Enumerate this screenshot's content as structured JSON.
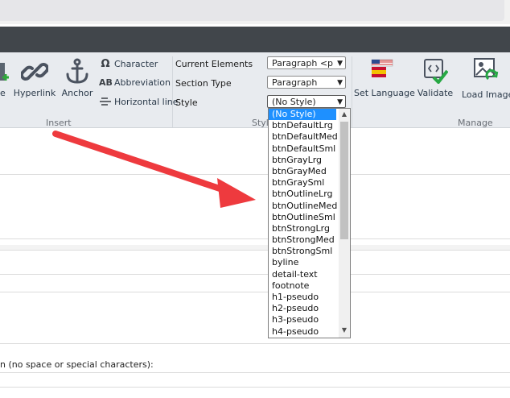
{
  "ribbon": {
    "partial_button_label": "e",
    "hyperlink_label": "Hyperlink",
    "anchor_label": "Anchor",
    "character_label": "Character",
    "character_icon": "Ω",
    "abbreviation_label": "Abbreviation",
    "abbreviation_icon": "AB",
    "horizontal_line_label": "Horizontal line",
    "insert_group_label": "Insert",
    "style_group_label": "Styl",
    "manage_group_label": "Manage",
    "set_language_label": "Set Language",
    "validate_label": "Validate",
    "load_images_label": "Load Images"
  },
  "properties": {
    "current_elements_label": "Current Elements",
    "current_elements_value": "Paragraph <p",
    "section_type_label": "Section Type",
    "section_type_value": "Paragraph",
    "style_label": "Style",
    "style_value": "(No Style)"
  },
  "style_dropdown": {
    "options": [
      "(No Style)",
      "btnDefaultLrg",
      "btnDefaultMed",
      "btnDefaultSml",
      "btnGrayLrg",
      "btnGrayMed",
      "btnGraySml",
      "btnOutlineLrg",
      "btnOutlineMed",
      "btnOutlineSml",
      "btnStrongLrg",
      "btnStrongMed",
      "btnStrongSml",
      "byline",
      "detail-text",
      "footnote",
      "h1-pseudo",
      "h2-pseudo",
      "h3-pseudo",
      "h4-pseudo"
    ],
    "selected_index": 0
  },
  "form": {
    "field_hint": "n (no space or special characters):"
  },
  "colors": {
    "arrow": "#ee3a3e",
    "selected_option": "#1e90ff",
    "toolbar_dark": "#41464b"
  }
}
